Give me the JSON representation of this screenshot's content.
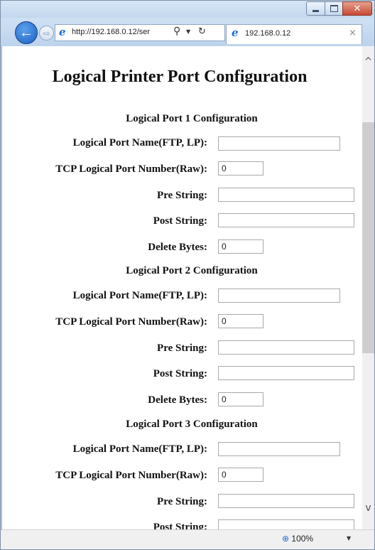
{
  "browser": {
    "address_url": "http://192.168.0.12/ser",
    "tab_title": "192.168.0.12",
    "zoom": "100%"
  },
  "page": {
    "title": "Logical Printer Port Configuration",
    "sections": [
      {
        "title": "Logical Port 1 Configuration",
        "fields": {
          "name_label": "Logical Port Name(FTP, LP):",
          "name_value": "",
          "tcp_label": "TCP Logical Port Number(Raw):",
          "tcp_value": "0",
          "pre_label": "Pre String:",
          "pre_value": "",
          "post_label": "Post String:",
          "post_value": "",
          "delete_label": "Delete Bytes:",
          "delete_value": "0"
        }
      },
      {
        "title": "Logical Port 2 Configuration",
        "fields": {
          "name_label": "Logical Port Name(FTP, LP):",
          "name_value": "",
          "tcp_label": "TCP Logical Port Number(Raw):",
          "tcp_value": "0",
          "pre_label": "Pre String:",
          "pre_value": "",
          "post_label": "Post String:",
          "post_value": "",
          "delete_label": "Delete Bytes:",
          "delete_value": "0"
        }
      },
      {
        "title": "Logical Port 3 Configuration",
        "fields": {
          "name_label": "Logical Port Name(FTP, LP):",
          "name_value": "",
          "tcp_label": "TCP Logical Port Number(Raw):",
          "tcp_value": "0",
          "pre_label": "Pre String:",
          "pre_value": "",
          "post_label": "Post String:",
          "post_value": ""
        }
      }
    ]
  },
  "icons": {
    "back": "back-arrow-icon",
    "forward": "forward-arrow-icon",
    "browser": "internet-explorer-icon",
    "search": "search-icon",
    "refresh": "refresh-icon",
    "zoom": "zoom-icon"
  },
  "colors": {
    "chrome": "#bcd3ec",
    "back_button": "#1c62c8",
    "close_button": "#c74a33"
  }
}
